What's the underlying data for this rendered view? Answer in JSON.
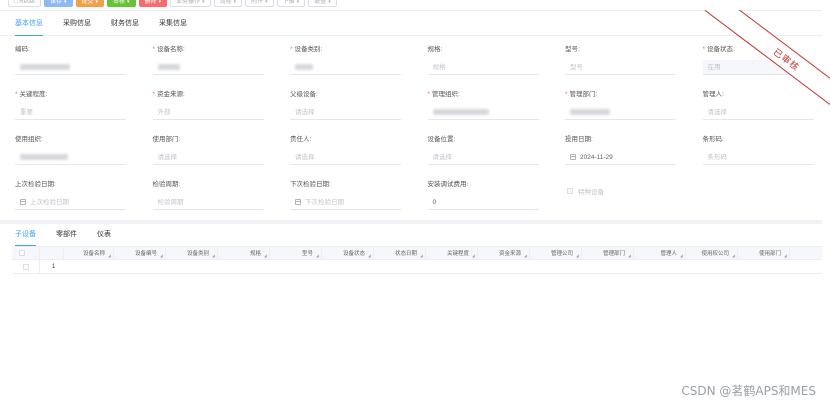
{
  "toolbar": {
    "buttons": [
      {
        "label": "□ Reset",
        "style": "plain"
      },
      {
        "label": "保存",
        "style": "blue"
      },
      {
        "label": "提交",
        "style": "orange"
      },
      {
        "label": "审核",
        "style": "green"
      },
      {
        "label": "删除",
        "style": "red"
      },
      {
        "label": "业务操作",
        "style": "plain"
      },
      {
        "label": "流程",
        "style": "plain"
      },
      {
        "label": "附件",
        "style": "plain"
      },
      {
        "label": "下推",
        "style": "plain"
      },
      {
        "label": "联查",
        "style": "plain"
      }
    ]
  },
  "top_tabs": [
    "基本信息",
    "采购信息",
    "财务信息",
    "采集信息"
  ],
  "stamp": {
    "text": "已审核",
    "color": "#c0392b"
  },
  "form": {
    "fields": [
      {
        "label": "编码:",
        "required": false,
        "value": "",
        "placeholder": "",
        "blurred": true
      },
      {
        "label": "设备名称:",
        "required": true,
        "value": "",
        "placeholder": "",
        "blurred": true
      },
      {
        "label": "设备类别:",
        "required": true,
        "value": "",
        "placeholder": "",
        "blurred": true
      },
      {
        "label": "规格:",
        "required": false,
        "value": "",
        "placeholder": "规格"
      },
      {
        "label": "型号:",
        "required": false,
        "value": "",
        "placeholder": "型号"
      },
      {
        "label": "设备状态:",
        "required": true,
        "value": "",
        "placeholder": "在用",
        "disabled": true
      },
      {
        "label": "关键程度:",
        "required": true,
        "value": "",
        "placeholder": "重要"
      },
      {
        "label": "资金来源:",
        "required": true,
        "value": "",
        "placeholder": "外部"
      },
      {
        "label": "父级设备:",
        "required": false,
        "value": "",
        "placeholder": "请选择"
      },
      {
        "label": "管理组织:",
        "required": true,
        "value": "",
        "placeholder": "",
        "blurred": true
      },
      {
        "label": "管理部门:",
        "required": true,
        "value": "",
        "placeholder": "",
        "blurred": true
      },
      {
        "label": "管理人:",
        "required": false,
        "value": "",
        "placeholder": "请选择"
      },
      {
        "label": "使用组织:",
        "required": false,
        "value": "",
        "placeholder": "",
        "blurred": true
      },
      {
        "label": "使用部门:",
        "required": false,
        "value": "",
        "placeholder": "请选择"
      },
      {
        "label": "责任人:",
        "required": false,
        "value": "",
        "placeholder": "请选择"
      },
      {
        "label": "设备位置:",
        "required": false,
        "value": "",
        "placeholder": "请选择"
      },
      {
        "label": "投用日期:",
        "required": false,
        "value": "2024-11-29",
        "placeholder": "",
        "calendar": true
      },
      {
        "label": "条形码:",
        "required": false,
        "value": "",
        "placeholder": "条形码"
      },
      {
        "label": "上次检验日期:",
        "required": false,
        "value": "",
        "placeholder": "上次检验日期",
        "calendar": true
      },
      {
        "label": "检验周期:",
        "required": false,
        "value": "",
        "placeholder": "检验周期"
      },
      {
        "label": "下次检验日期:",
        "required": false,
        "value": "",
        "placeholder": "下次检验日期",
        "calendar": true
      },
      {
        "label": "安装调试费用:",
        "required": false,
        "value": "0",
        "placeholder": ""
      }
    ],
    "special_checkbox_label": "特种设备"
  },
  "bottom_tabs": [
    "子设备",
    "零部件",
    "仪表"
  ],
  "grid": {
    "columns": [
      "设备名称",
      "设备编号",
      "设备类别",
      "规格",
      "型号",
      "设备状态",
      "状态日期",
      "关键程度",
      "资金来源",
      "管理公司",
      "管理部门",
      "管理人",
      "使用权公司",
      "使用部门"
    ],
    "rows": [
      {
        "index": "1"
      }
    ]
  },
  "watermark": "CSDN @茗鹤APS和MES"
}
